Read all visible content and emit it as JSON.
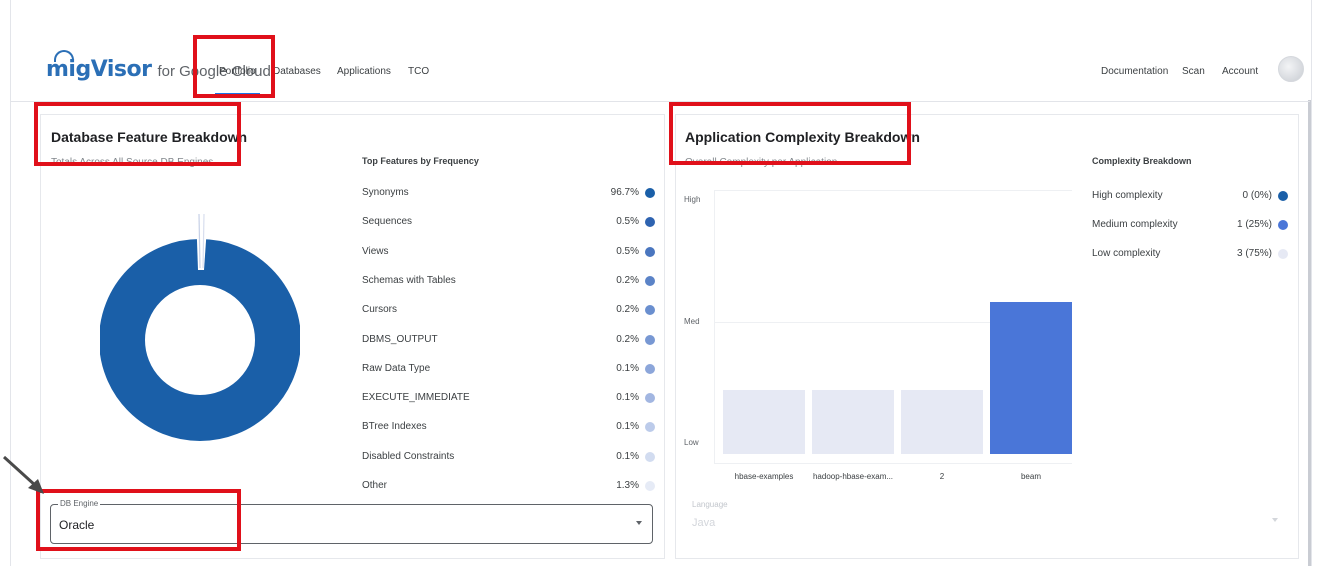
{
  "nav": {
    "logo_text": "migVisor",
    "logo_suffix": "for Google Cloud",
    "links": [
      "Portfolio",
      "Databases",
      "Applications",
      "TCO"
    ],
    "active": "Portfolio",
    "right_links": [
      "Documentation",
      "Scan",
      "Account"
    ]
  },
  "db_panel": {
    "title": "Database Feature Breakdown",
    "subtitle": "Totals Across All Source DB Engines",
    "features_heading": "Top Features by Frequency",
    "features": [
      {
        "label": "Synonyms",
        "value": "96.7%",
        "color": "#1a5fa8"
      },
      {
        "label": "Sequences",
        "value": "0.5%",
        "color": "#2e63b0"
      },
      {
        "label": "Views",
        "value": "0.5%",
        "color": "#4a76bf"
      },
      {
        "label": "Schemas with Tables",
        "value": "0.2%",
        "color": "#5b83c7"
      },
      {
        "label": "Cursors",
        "value": "0.2%",
        "color": "#6a8fcf"
      },
      {
        "label": "DBMS_OUTPUT",
        "value": "0.2%",
        "color": "#7898d3"
      },
      {
        "label": "Raw Data Type",
        "value": "0.1%",
        "color": "#8ca6da"
      },
      {
        "label": "EXECUTE_IMMEDIATE",
        "value": "0.1%",
        "color": "#a2b6e1"
      },
      {
        "label": "BTree Indexes",
        "value": "0.1%",
        "color": "#bccbea"
      },
      {
        "label": "Disabled Constraints",
        "value": "0.1%",
        "color": "#d2dcf0"
      },
      {
        "label": "Other",
        "value": "1.3%",
        "color": "#e6ebf6"
      }
    ],
    "engine_select": {
      "label": "DB Engine",
      "value": "Oracle"
    }
  },
  "app_panel": {
    "title": "Application Complexity Breakdown",
    "subtitle": "Overall Complexity per Application",
    "breakdown_heading": "Complexity Breakdown",
    "breakdown": [
      {
        "label": "High complexity",
        "value": "0 (0%)",
        "color": "#1a5fa8"
      },
      {
        "label": "Medium complexity",
        "value": "1 (25%)",
        "color": "#4a76d8"
      },
      {
        "label": "Low complexity",
        "value": "3 (75%)",
        "color": "#e6e9f4"
      }
    ],
    "language_select": {
      "label": "Language",
      "value": "Java"
    }
  },
  "chart_data": {
    "type": "bar",
    "categories": [
      "hbase-examples",
      "hadoop-hbase-exam...",
      "2",
      "beam"
    ],
    "values": [
      1,
      1,
      1,
      2
    ],
    "y_tick_labels": [
      "Low",
      "Med",
      "High"
    ],
    "colors": [
      "#e6e9f4",
      "#e6e9f4",
      "#e6e9f4",
      "#4a76d8"
    ]
  },
  "colors": {
    "annotation": "#e0101a",
    "primary": "#1a5fa8",
    "accent": "#4a76d8"
  }
}
